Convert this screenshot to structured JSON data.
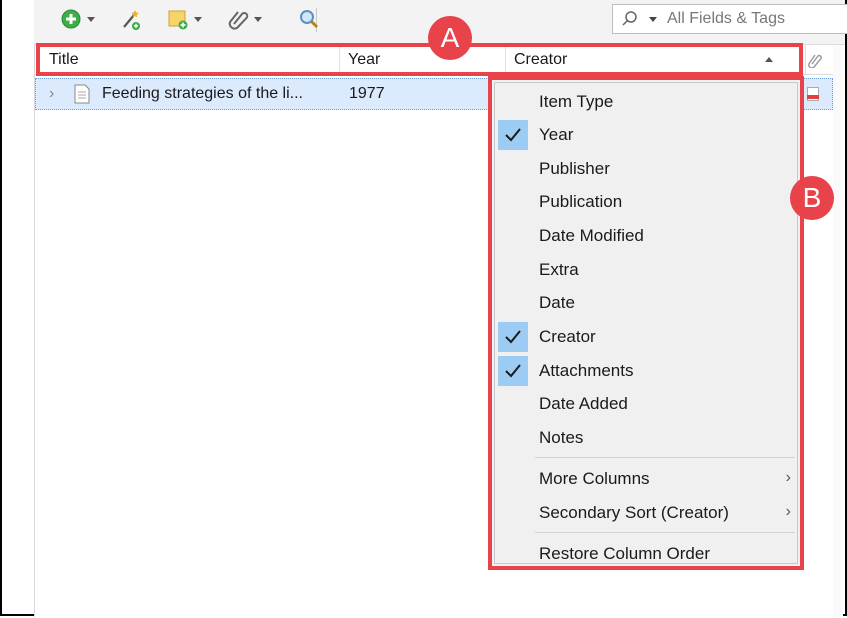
{
  "search": {
    "placeholder": "All Fields & Tags"
  },
  "columns": {
    "title": "Title",
    "year": "Year",
    "creator": "Creator"
  },
  "row": {
    "title": "Feeding strategies of the li...",
    "year": "1977"
  },
  "annotations": {
    "a": "A",
    "b": "B"
  },
  "menu": {
    "items": [
      {
        "label": "Item Type",
        "checked": false
      },
      {
        "label": "Year",
        "checked": true
      },
      {
        "label": "Publisher",
        "checked": false
      },
      {
        "label": "Publication",
        "checked": false
      },
      {
        "label": "Date Modified",
        "checked": false
      },
      {
        "label": "Extra",
        "checked": false
      },
      {
        "label": "Date",
        "checked": false
      },
      {
        "label": "Creator",
        "checked": true
      },
      {
        "label": "Attachments",
        "checked": true
      },
      {
        "label": "Date Added",
        "checked": false
      },
      {
        "label": "Notes",
        "checked": false
      }
    ],
    "more_columns": "More Columns",
    "secondary_sort": "Secondary Sort (Creator)",
    "restore_order": "Restore Column Order"
  },
  "colors": {
    "annotation": "#e8424a",
    "check_bg": "#9ccbf3",
    "row_selected": "#dbeafc"
  }
}
